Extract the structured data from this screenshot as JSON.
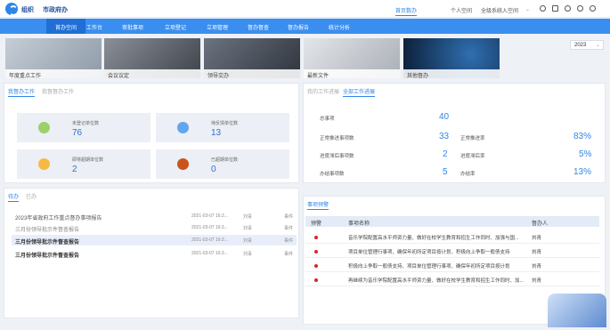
{
  "header": {
    "org": "组织",
    "title": "市政府办",
    "nav": [
      "首页数办",
      "个人空间",
      "全级系统入空间"
    ]
  },
  "mainnav": [
    "首办空间",
    "工作台",
    "审批事项",
    "立项登记",
    "立项管理",
    "督办督查",
    "督办报告",
    "统计分析"
  ],
  "banners": [
    {
      "label": "年度重点工作",
      "color": "#9aa7b6"
    },
    {
      "label": "会议议定",
      "color": "#5a5f68"
    },
    {
      "label": "领导交办",
      "color": "#4b5563"
    },
    {
      "label": "最新文件",
      "color": "#c9cdd3"
    },
    {
      "label": "其他督办",
      "color": "#0f2846"
    }
  ],
  "year": "2023",
  "overview": {
    "tabs": [
      "我督办工作",
      "我督督办工作"
    ],
    "cards": [
      {
        "label": "未登记单位数",
        "value": "76",
        "color": "#9ad16a"
      },
      {
        "label": "待反馈单位数",
        "value": "13",
        "color": "#62a6f0"
      },
      {
        "label": "即将超期单位数",
        "value": "2",
        "color": "#f7b945"
      },
      {
        "label": "已超期单位数",
        "value": "0",
        "color": "#c9541c"
      }
    ]
  },
  "progress": {
    "tabs": [
      "我的工作进展",
      "全部工作进展"
    ],
    "rows": [
      {
        "label": "总事项",
        "value": "40"
      },
      {
        "label": "正常推进事项数",
        "value": "33",
        "rlabel": "正常推进率",
        "rvalue": "83%"
      },
      {
        "label": "进度滞后事项数",
        "value": "2",
        "rlabel": "进度滞后率",
        "rvalue": "5%"
      },
      {
        "label": "办结事项数",
        "value": "5",
        "rlabel": "办结率",
        "rvalue": "13%"
      }
    ]
  },
  "todo": {
    "tabs": [
      "待办",
      "已办"
    ],
    "rows": [
      {
        "title": "2023年省政府工作重点督办事项报告",
        "time": "2021-03-07 16:3...",
        "user": "刘青",
        "type": "事件"
      },
      {
        "title": "三月份领导批示件督查报告",
        "time": "2021-03-07 16:3...",
        "user": "刘青",
        "type": "事件"
      },
      {
        "title": "三月份领导批示件督查报告",
        "time": "2021-03-07 16:3...",
        "user": "刘青",
        "type": "事件"
      },
      {
        "title": "三月份领导批示件督查报告",
        "time": "2021-03-07 16:3...",
        "user": "刘青",
        "type": "事件"
      }
    ]
  },
  "warn": {
    "tab": "事项预警",
    "cols": [
      "预警",
      "事项名称",
      "督办人"
    ],
    "rows": [
      {
        "name": "音乐学院配置高水平师资力量、做好在校学生教育和招生工作同时、加强与国...",
        "user": "刘青"
      },
      {
        "name": "项目单位管理行事项、确保年初所定项目按计划、积极向上争取一般债支持",
        "user": "刘青"
      },
      {
        "name": "积极向上争取一般债支持、项目单位管理行事项、确保年初所定项目按计划",
        "user": "刘青"
      },
      {
        "name": "再继续为音乐学院配置高水平师资力量、做好在校学生教育和招生工作同时、加...",
        "user": "刘青"
      }
    ]
  }
}
